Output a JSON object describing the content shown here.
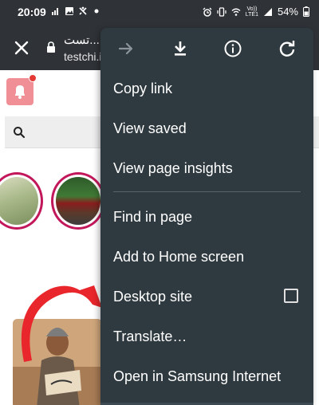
{
  "status_bar": {
    "time": "20:09",
    "battery": "54%",
    "volte_top": "Vo))",
    "volte_bottom": "LTE1"
  },
  "toolbar": {
    "page_title": "تست...",
    "url_host": "testchi.i"
  },
  "menu": {
    "items": [
      {
        "label": "Copy link"
      },
      {
        "label": "View saved"
      },
      {
        "label": "View page insights"
      },
      {
        "label": "Find in page"
      },
      {
        "label": "Add to Home screen"
      },
      {
        "label": "Desktop site"
      },
      {
        "label": "Translate…"
      },
      {
        "label": "Open in Samsung Internet"
      }
    ],
    "desktop_site_checked": false
  },
  "icons": {
    "status": [
      "signal-icon",
      "image-icon",
      "notification-icon",
      "dot-icon",
      "alarm-icon",
      "vibrate-icon",
      "wifi-icon",
      "battery-icon"
    ],
    "toolbar": [
      "close-icon",
      "lock-icon"
    ],
    "menu": [
      "forward-icon",
      "download-icon",
      "info-icon",
      "reload-icon"
    ],
    "page": [
      "bell-icon",
      "search-icon"
    ]
  },
  "colors": {
    "toolbar_bg": "#2f3338",
    "menu_bg": "#2f3a40",
    "bell_bg": "#f08f95",
    "story_ring": "#c2185b"
  }
}
